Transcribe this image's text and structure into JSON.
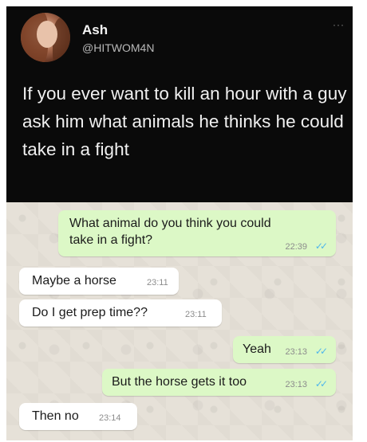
{
  "tweet": {
    "name": "Ash",
    "handle": "@HITWOM4N",
    "more_icon": "···",
    "text": "If you ever want to kill an hour with a guy ask him what animals he thinks he could take in a fight"
  },
  "chat": {
    "messages": [
      {
        "direction": "outgoing",
        "text_line1": "What animal do you think you could",
        "text_line2": "take in a fight?",
        "time": "22:39",
        "read_icon": "double-check-icon"
      },
      {
        "direction": "incoming",
        "text": "Maybe a horse",
        "time": "23:11"
      },
      {
        "direction": "incoming",
        "text": "Do I get prep time??",
        "time": "23:11"
      },
      {
        "direction": "outgoing",
        "text": "Yeah",
        "time": "23:13",
        "read_icon": "double-check-icon"
      },
      {
        "direction": "outgoing",
        "text": "But the horse gets it too",
        "time": "23:13",
        "read_icon": "double-check-icon"
      },
      {
        "direction": "incoming",
        "text": "Then no",
        "time": "23:14"
      }
    ],
    "colors": {
      "outgoing_bubble": "#dcf8c6",
      "incoming_bubble": "#ffffff",
      "read_ticks": "#4fb6ec",
      "wallpaper": "#e6e1d8"
    }
  }
}
